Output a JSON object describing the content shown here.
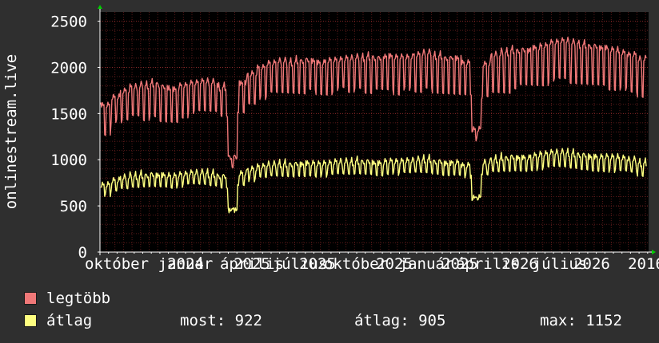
{
  "chart_data": {
    "type": "line",
    "ylabel": "onlinestream.live",
    "ylim": [
      0,
      2600
    ],
    "y_ticks": [
      0,
      500,
      1000,
      1500,
      2000,
      2500
    ],
    "x_tick_labels": [
      "október",
      "január",
      "2024",
      "április",
      "2025",
      "július",
      "2025",
      "október",
      "2025",
      "január",
      "2025",
      "április",
      "2026",
      "július",
      "2026",
      "2016"
    ],
    "grid": true,
    "colors": {
      "max": "#f07878",
      "avg": "#ffff80",
      "background": "#000000",
      "grid": "#5a1a1a",
      "axis": "#ffffff",
      "arrow": "#00cc00"
    },
    "series": [
      {
        "name": "legtöbb",
        "color": "#f07878",
        "base": [
          1620,
          1700,
          1760,
          1800,
          1820,
          1840,
          1810,
          1790,
          1830,
          1850,
          1860,
          1850,
          1800,
          1050,
          1860,
          1960,
          2020,
          2060,
          2080,
          2070,
          2090,
          2100,
          2080,
          2100,
          2100,
          2110,
          2120,
          2130,
          2120,
          2150,
          2140,
          2130,
          2150,
          2170,
          2140,
          2120,
          2130,
          2080,
          1350,
          2050,
          2150,
          2180,
          2200,
          2210,
          2240,
          2260,
          2290,
          2300,
          2280,
          2260,
          2250,
          2240,
          2220,
          2180,
          2150,
          2100
        ],
        "dip": [
          1260,
          1400,
          1400,
          1450,
          1400,
          1450,
          1400,
          1400,
          1450,
          1500,
          1500,
          1500,
          1450,
          900,
          1500,
          1600,
          1650,
          1700,
          1700,
          1700,
          1700,
          1750,
          1700,
          1700,
          1750,
          1700,
          1750,
          1700,
          1750,
          1750,
          1700,
          1750,
          1700,
          1750,
          1700,
          1700,
          1700,
          1700,
          1200,
          1650,
          1700,
          1700,
          1750,
          1800,
          1800,
          1800,
          1850,
          1850,
          1800,
          1800,
          1800,
          1800,
          1750,
          1750,
          1700,
          1650
        ]
      },
      {
        "name": "átlag",
        "color": "#ffff80",
        "base": [
          750,
          790,
          820,
          840,
          850,
          860,
          860,
          850,
          860,
          870,
          870,
          860,
          840,
          480,
          880,
          920,
          940,
          960,
          970,
          970,
          980,
          990,
          980,
          980,
          990,
          990,
          1000,
          1000,
          990,
          1010,
          1000,
          1000,
          1010,
          1020,
          1000,
          990,
          1000,
          960,
          600,
          980,
          1020,
          1040,
          1050,
          1050,
          1070,
          1080,
          1090,
          1090,
          1080,
          1070,
          1060,
          1060,
          1050,
          1030,
          1010,
          980
        ],
        "dip": [
          600,
          630,
          660,
          680,
          690,
          700,
          700,
          690,
          700,
          710,
          710,
          700,
          680,
          460,
          720,
          760,
          780,
          800,
          800,
          800,
          810,
          820,
          810,
          810,
          820,
          820,
          830,
          830,
          820,
          840,
          830,
          830,
          840,
          840,
          830,
          820,
          830,
          800,
          560,
          810,
          850,
          860,
          870,
          870,
          880,
          890,
          900,
          900,
          890,
          880,
          870,
          870,
          860,
          850,
          840,
          800
        ]
      }
    ]
  },
  "legend": [
    {
      "name": "legtöbb",
      "color": "#f07878"
    },
    {
      "name": "átlag",
      "color": "#ffff80"
    }
  ],
  "stats": {
    "most": "most: 922",
    "atlag": "átlag: 905",
    "max": "max: 1152"
  }
}
